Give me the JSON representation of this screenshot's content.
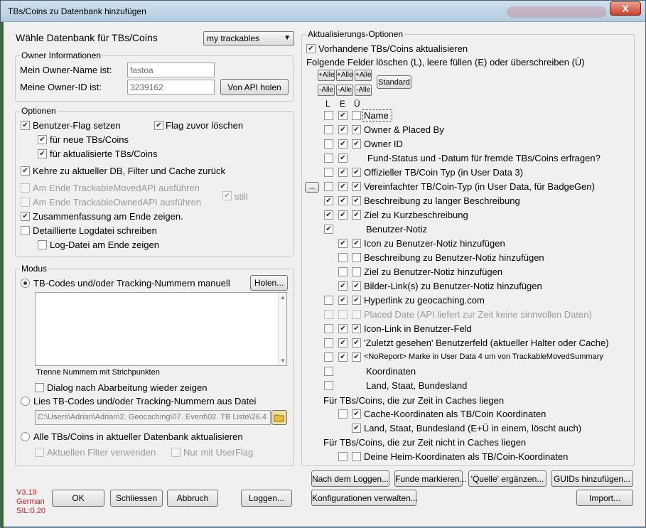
{
  "window": {
    "title": "TBs/Coins zu Datenbank hinzufügen",
    "close_glyph": "X"
  },
  "left": {
    "db_label": "Wähle Datenbank für TBs/Coins",
    "db_select": "my trackables",
    "owner": {
      "legend": "Owner Informationen",
      "name_label": "Mein Owner-Name ist:",
      "name_value": "fastoa",
      "id_label": "Meine Owner-ID ist:",
      "id_value": "3239162",
      "api_button": "Von API holen"
    },
    "options": {
      "legend": "Optionen",
      "user_flag": "Benutzer-Flag setzen",
      "clear_flag": "Flag zuvor löschen",
      "for_new": "für neue TBs/Coins",
      "for_updated": "für aktualisierte TBs/Coins",
      "return_db": "Kehre zu aktueller DB, Filter und Cache zurück",
      "moved_api": "Am Ende TrackableMovedAPI ausführen",
      "owned_api": "Am Ende TrackableOwnedAPI ausführen",
      "still": "still",
      "summary": "Zusammenfassung am Ende zeigen.",
      "logfile": "Detaillierte Logdatei schreiben",
      "show_log": "Log-Datei am Ende zeigen"
    },
    "modus": {
      "legend": "Modus",
      "manual": "TB-Codes und/oder Tracking-Nummern manuell",
      "holen_button": "Holen...",
      "separator_hint": "Trenne Nummern mit Strichpunkten",
      "dialog_again": "Dialog nach Abarbeitung wieder zeigen",
      "from_file": "Lies TB-Codes und/oder Tracking-Nummern aus Datei",
      "file_path": "C:\\Users\\Adrian\\Adrian\\2. Geocaching\\07. Event\\02. TB Liste\\26.4",
      "all_update": "Alle TBs/Coins in aktueller Datenbank aktualisieren",
      "current_filter": "Aktuellen Filter verwenden",
      "only_userflag": "Nur mit UserFlag"
    },
    "version": [
      "V3.19",
      "German",
      "SIL:0.20"
    ],
    "buttons": {
      "ok": "OK",
      "schliessen": "Schliessen",
      "abbruch": "Abbruch",
      "loggen": "Loggen..."
    }
  },
  "right": {
    "legend": "Aktualisierungs-Optionen",
    "update_existing": "Vorhandene TBs/Coins aktualisieren",
    "fields_hint": "Folgende Felder löschen (L), leere füllen (E) oder überschreiben (Ü)",
    "plus_all": "+Alle",
    "minus_all": "-Alle",
    "standard_button": "Standard",
    "col_headers": [
      "L",
      "E",
      "Ü"
    ],
    "ellipsis_button": "...",
    "fields": [
      {
        "label": "Name",
        "l": false,
        "e": true,
        "u": false
      },
      {
        "label": "Owner & Placed By",
        "l": false,
        "e": true,
        "u": true
      },
      {
        "label": "Owner ID",
        "l": false,
        "e": true,
        "u": true
      },
      {
        "label": "Fund-Status und -Datum für fremde TBs/Coins erfragen?",
        "l": false,
        "e": true
      },
      {
        "label": "Offizieller TB/Coin Typ (in User Data 3)",
        "l": false,
        "e": true,
        "u": true
      },
      {
        "label": "Vereinfachter TB/Coin-Typ (in User Data, für BadgeGen)",
        "l": false,
        "e": true,
        "u": true
      },
      {
        "label": "Beschreibung zu langer Beschreibung",
        "l": true,
        "e": true,
        "u": true
      },
      {
        "label": "Ziel zu Kurzbeschreibung",
        "l": true,
        "e": true,
        "u": true
      },
      {
        "label": "Benutzer-Notiz",
        "l": true
      },
      {
        "label": "Icon zu Benutzer-Notiz hinzufügen",
        "e": true,
        "u": true
      },
      {
        "label": "Beschreibung zu Benutzer-Notiz hinzufügen",
        "e": false,
        "u": false
      },
      {
        "label": "Ziel zu Benutzer-Notiz hinzufügen",
        "e": false,
        "u": false
      },
      {
        "label": "Bilder-Link(s) zu Benutzer-Notiz hinzufügen",
        "e": true,
        "u": true
      },
      {
        "label": "Hyperlink zu geocaching.com",
        "l": false,
        "e": true,
        "u": true
      },
      {
        "label": "Placed Date (API liefert zur Zeit keine sinnvollen Daten)",
        "l": false,
        "e": false,
        "u": false,
        "disabled": true
      },
      {
        "label": "Icon-Link in Benutzer-Feld",
        "l": false,
        "e": true,
        "u": true
      },
      {
        "label": "'Zuletzt gesehen' Benutzerfeld (aktueller Halter oder Cache)",
        "l": false,
        "e": true,
        "u": true
      },
      {
        "label": "<NoReport> Marke in User Data 4 um von TrackableMovedSummary",
        "l": false,
        "e": true,
        "u": true,
        "small": true
      },
      {
        "label": "Koordinaten",
        "l": false
      },
      {
        "label": "Land, Staat, Bundesland",
        "l": false
      }
    ],
    "in_caches_label": "Für TBs/Coins, die zur Zeit in Caches liegen",
    "cache_coords": "Cache-Koordinaten als TB/Coin Koordinaten",
    "land_staat": "Land, Staat, Bundesland (E+Ü in einem, löscht auch)",
    "not_in_caches_label": "Für TBs/Coins, die zur Zeit nicht in Caches liegen",
    "home_coords": "Deine Heim-Koordinaten als TB/Coin-Koordinaten",
    "buttons": {
      "nach_loggen": "Nach dem Loggen...",
      "funde": "Funde markieren...",
      "quelle": "'Quelle' ergänzen...",
      "guids": "GUIDs hinzufügen...",
      "konfig": "Konfigurationen verwalten...",
      "import": "Import..."
    }
  }
}
